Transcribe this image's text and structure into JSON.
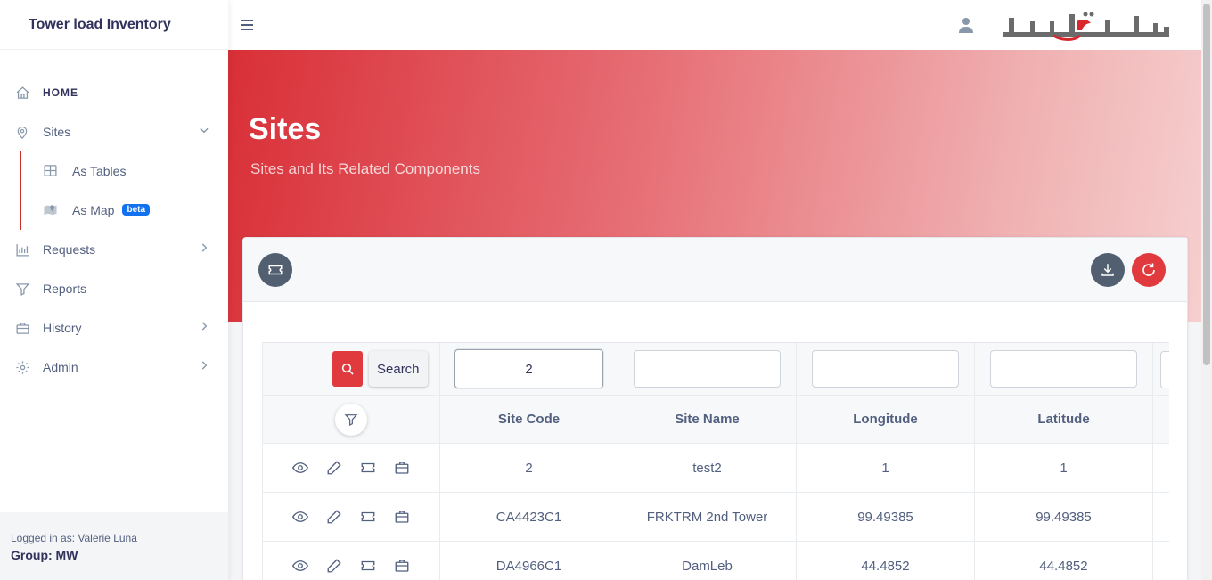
{
  "app": {
    "title": "Tower load Inventory"
  },
  "sidebar": {
    "items": [
      {
        "label": "HOME",
        "icon": "home-icon"
      },
      {
        "label": "Sites",
        "icon": "map-pin-icon",
        "expanded": true,
        "children": [
          {
            "label": "As Tables",
            "icon": "table-icon"
          },
          {
            "label": "As Map",
            "icon": "map-icon",
            "badge": "beta"
          }
        ]
      },
      {
        "label": "Requests",
        "icon": "bar-chart-icon"
      },
      {
        "label": "Reports",
        "icon": "funnel-icon"
      },
      {
        "label": "History",
        "icon": "briefcase-icon"
      },
      {
        "label": "Admin",
        "icon": "gear-icon"
      }
    ],
    "footer": {
      "logged_in": "Logged in as: Valerie Luna",
      "group": "Group: MW"
    }
  },
  "header": {
    "title": "Sites",
    "subtitle": "Sites and Its Related Components"
  },
  "colors": {
    "accent": "#e03a3f",
    "dark_button": "#525f70",
    "beta_badge": "#1171ef"
  },
  "table": {
    "search_tooltip": "Search",
    "filters": [
      "2",
      "",
      "",
      ""
    ],
    "columns": [
      "Site Code",
      "Site Name",
      "Longitude",
      "Latitude"
    ],
    "rows": [
      {
        "site_code": "2",
        "site_name": "test2",
        "longitude": "1",
        "latitude": "1"
      },
      {
        "site_code": "CA4423C1",
        "site_name": "FRKTRM 2nd Tower",
        "longitude": "99.49385",
        "latitude": "99.49385"
      },
      {
        "site_code": "DA4966C1",
        "site_name": "DamLeb",
        "longitude": "44.4852",
        "latitude": "44.4852"
      }
    ]
  }
}
